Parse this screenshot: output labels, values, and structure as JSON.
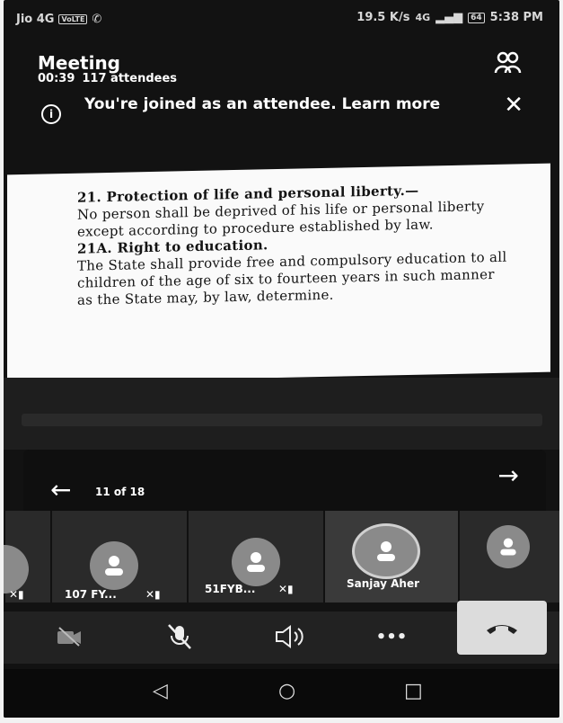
{
  "status": {
    "carrier": "Jio 4G",
    "carrier_badge": "VoLTE",
    "speed": "19.5 K/s",
    "signal": "4G",
    "battery": "64",
    "time": "5:38 PM"
  },
  "meeting": {
    "title": "Meeting",
    "elapsed": "00:39",
    "attendees": "117 attendees"
  },
  "banner": {
    "text": "You're joined as an attendee. Learn more",
    "info": "i",
    "close": "✕"
  },
  "document": {
    "heading1": "21. Protection of life and personal liberty.—",
    "body1": "No person shall be deprived of his life or personal liberty except according to procedure established by law.",
    "heading2": "21A. Right to education.",
    "body2": "The State shall provide free and compulsory education to all children of the age of six to fourteen years in such manner as the State may, by law, determine."
  },
  "pager": {
    "indicator": "11 of 18",
    "prev": "←",
    "next": "→"
  },
  "participants": [
    {
      "name": ""
    },
    {
      "name": "107 FY..."
    },
    {
      "name": "51FYB..."
    },
    {
      "name": "Sanjay Aher"
    },
    {
      "name": ""
    }
  ],
  "toolbar": {
    "more": "•••"
  },
  "navbar": {
    "back": "◁",
    "home": "○",
    "recent": "□"
  }
}
